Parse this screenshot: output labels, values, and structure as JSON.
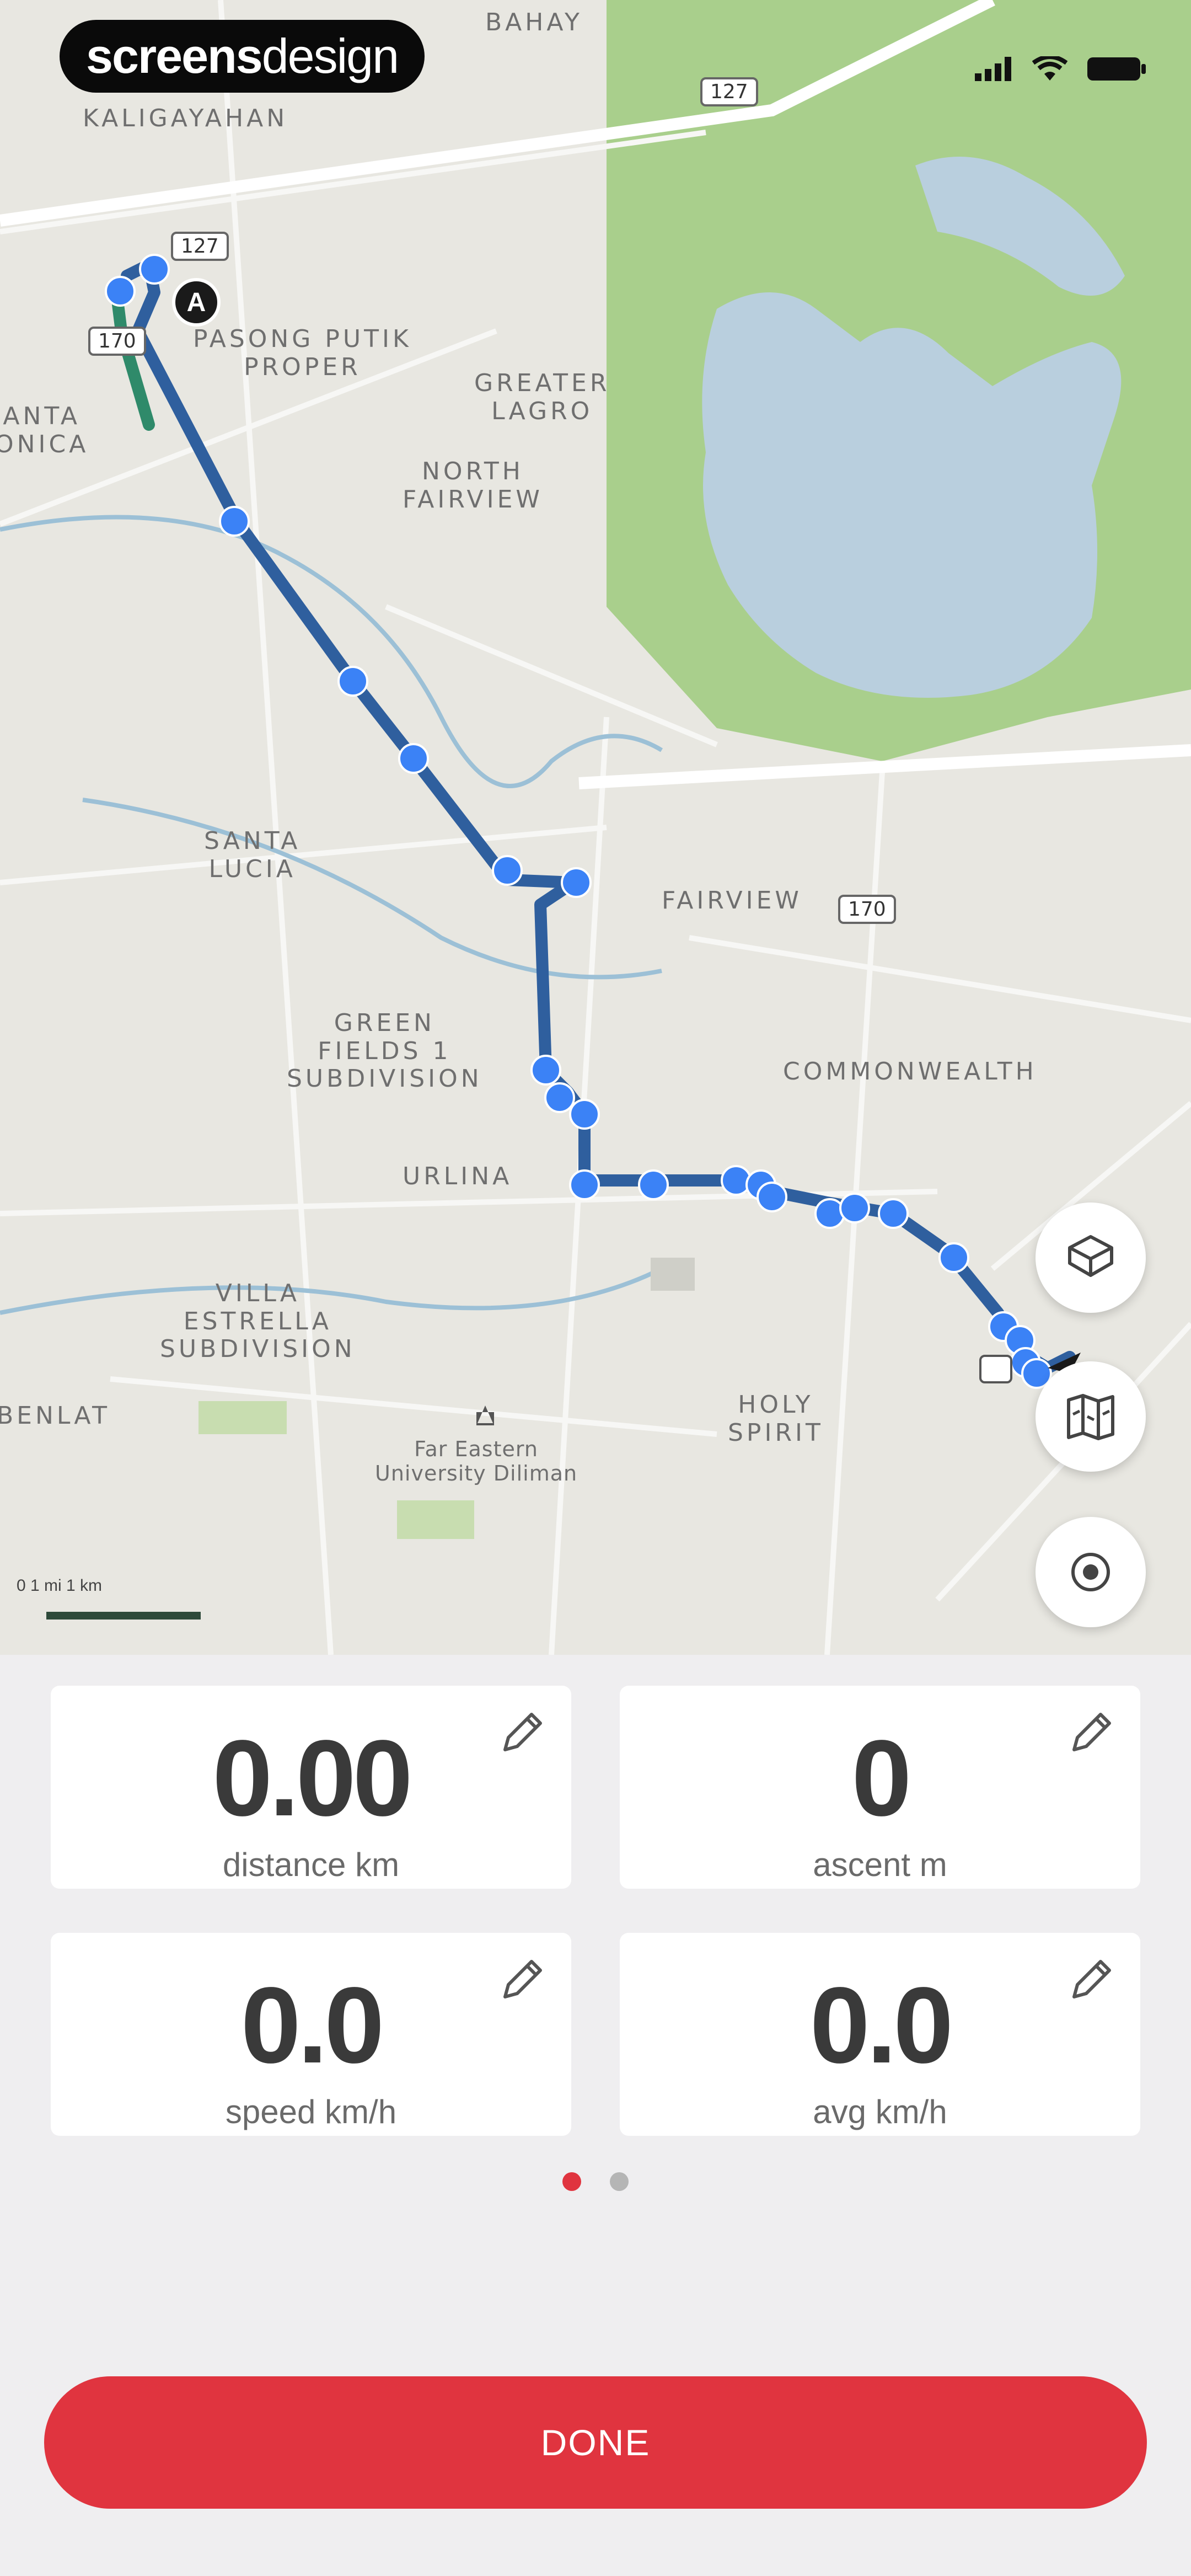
{
  "watermark": {
    "bold": "screens",
    "light": "design"
  },
  "map": {
    "labels": {
      "kaligayahan": "KALIGAYAHAN",
      "bahay": "BAHAY",
      "pasong_putik": "PASONG PUTIK\nPROPER",
      "greater_lagro": "GREATER\nLAGRO",
      "north_fairview": "NORTH\nFAIRVIEW",
      "anta_monica": "ANTA\nONICA",
      "santa_lucia": "SANTA\nLUCIA",
      "fairview": "FAIRVIEW",
      "green_fields": "GREEN\nFIELDS 1\nSUBDIVISION",
      "urlina": "URLINA",
      "commonwealth": "COMMONWEALTH",
      "villa_estrella": "VILLA\nESTRELLA\nSUBDIVISION",
      "benlat": "BENLAT",
      "holy_spirit": "HOLY\nSPIRIT",
      "university": "Far Eastern\nUniversity Diliman"
    },
    "shields": {
      "s127a": "127",
      "s127b": "127",
      "s170a": "170",
      "s170b": "170"
    },
    "start_marker": "A",
    "scale_text": "0  1 mi        1 km",
    "route_color": "#2f5f9e",
    "route_start_color": "#2f8a6a",
    "waypoint_color": "#3b82f6"
  },
  "map_controls": {
    "layers_icon": "layers-icon",
    "map_style_icon": "map-icon",
    "locate_icon": "locate-icon"
  },
  "stats": [
    {
      "value": "0.00",
      "label": "distance km",
      "icon": "pencil-icon"
    },
    {
      "value": "0",
      "label": "ascent m",
      "icon": "pencil-icon"
    },
    {
      "value": "0.0",
      "label": "speed km/h",
      "icon": "pencil-icon"
    },
    {
      "value": "0.0",
      "label": "avg km/h",
      "icon": "pencil-icon"
    }
  ],
  "pager": {
    "current_page": 1,
    "page_count": 2,
    "active_color": "#e0343f",
    "inactive_color": "#b5b5b5"
  },
  "done_button": {
    "label": "DONE",
    "color": "#e0343f"
  }
}
